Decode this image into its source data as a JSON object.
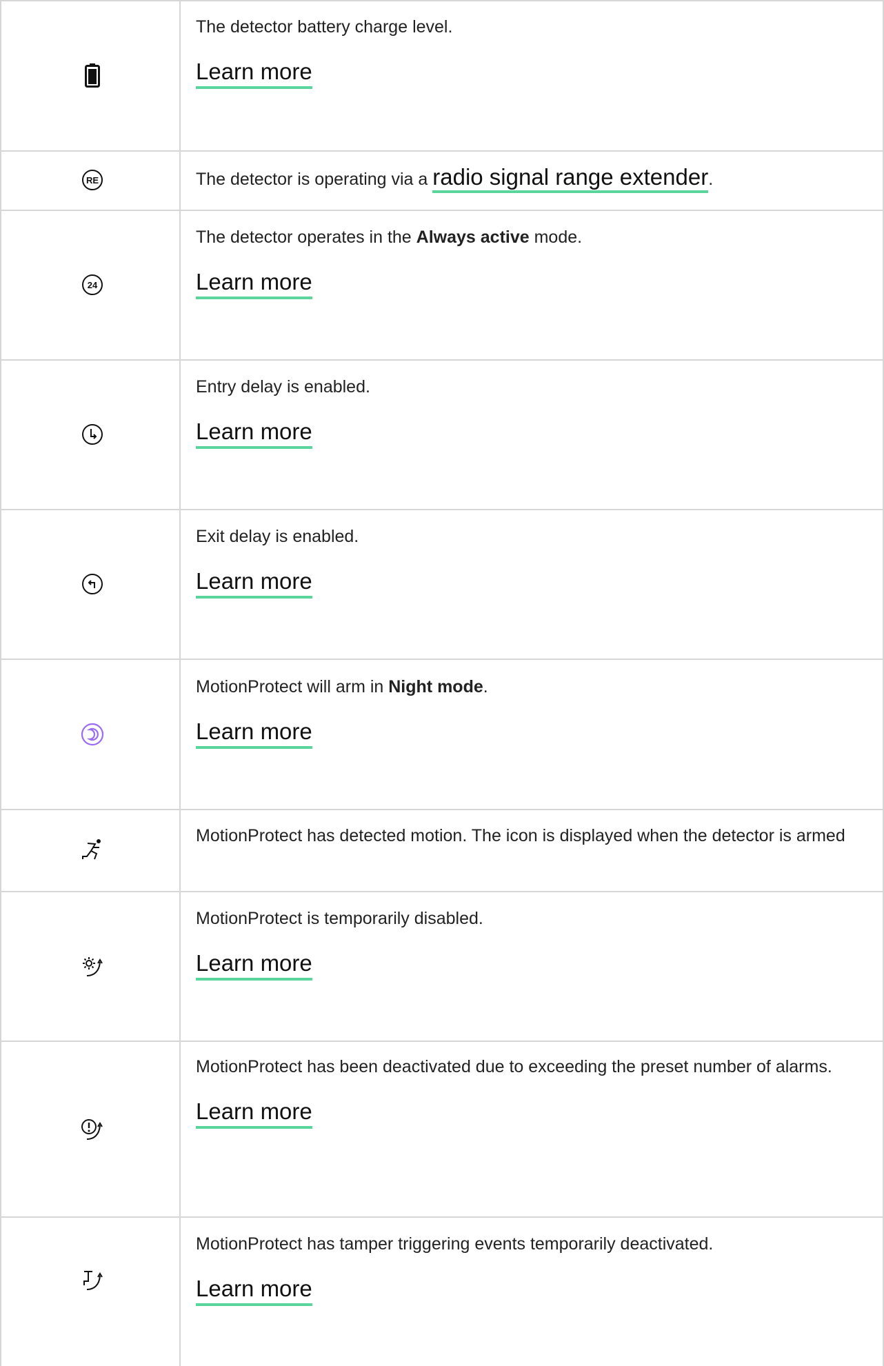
{
  "link_color": "#5ad59c",
  "night_icon_color": "#9b6bf2",
  "rows": [
    {
      "icon": "battery-icon",
      "text": "The detector battery charge level.",
      "link": "Learn more"
    },
    {
      "icon": "range-extender-icon",
      "icon_text": "RE",
      "pre": "The detector is operating via a ",
      "inline_link": "radio signal range extender",
      "post": "."
    },
    {
      "icon": "always-active-icon",
      "icon_text": "24",
      "pre": "The detector operates in the ",
      "bold": "Always active",
      "post": " mode.",
      "link": "Learn more"
    },
    {
      "icon": "entry-delay-icon",
      "text": "Entry delay is enabled.",
      "link": "Learn more"
    },
    {
      "icon": "exit-delay-icon",
      "text": "Exit delay is enabled.",
      "link": "Learn more"
    },
    {
      "icon": "night-mode-icon",
      "pre": "MotionProtect will arm in ",
      "bold": "Night mode",
      "post": ".",
      "link": "Learn more"
    },
    {
      "icon": "motion-detected-icon",
      "text": "MotionProtect has detected motion. The icon is displayed when the detector is armed"
    },
    {
      "icon": "temporarily-disabled-icon",
      "text": "MotionProtect is temporarily disabled.",
      "link": "Learn more"
    },
    {
      "icon": "alarms-exceeded-icon",
      "text": "MotionProtect has been deactivated due to exceeding the preset number of alarms.",
      "link": "Learn more"
    },
    {
      "icon": "tamper-deactivated-icon",
      "text": "MotionProtect has tamper triggering events temporarily deactivated.",
      "link": "Learn more"
    }
  ]
}
